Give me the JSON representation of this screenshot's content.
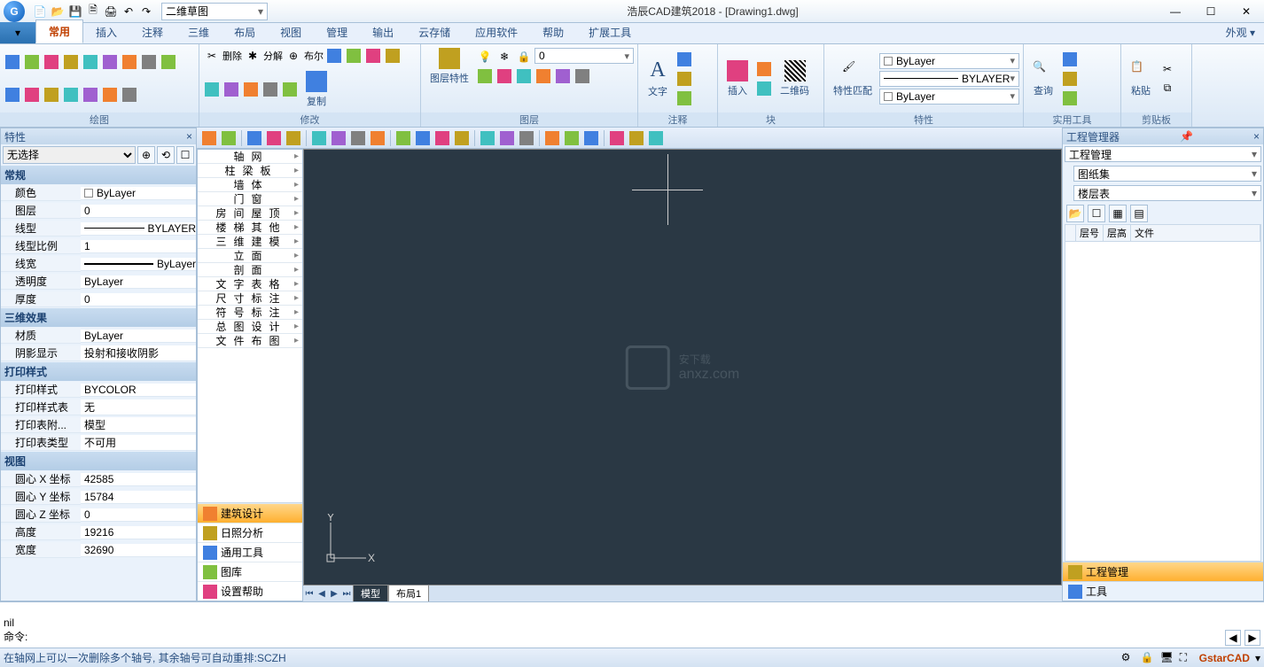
{
  "app": {
    "title": "浩辰CAD建筑2018 - [Drawing1.dwg]",
    "workspace": "二维草图",
    "brand": "GstarCAD",
    "appearance": "外观"
  },
  "tabs": [
    "常用",
    "插入",
    "注释",
    "三维",
    "布局",
    "视图",
    "管理",
    "输出",
    "云存储",
    "应用软件",
    "帮助",
    "扩展工具"
  ],
  "ribbon": {
    "groups": [
      "绘图",
      "修改",
      "图层",
      "注释",
      "块",
      "特性",
      "实用工具",
      "剪贴板"
    ],
    "btn_delete": "删除",
    "btn_explode": "分解",
    "btn_bool": "布尔",
    "btn_copy": "复制",
    "btn_text": "文字",
    "btn_insert": "插入",
    "btn_qr": "二维码",
    "btn_matchprop": "特性匹配",
    "btn_props": "图层特性",
    "btn_find": "查询",
    "btn_paste": "粘贴",
    "layer_val": "0",
    "color_val": "ByLayer",
    "ltype_val": "ByLayer",
    "lweight_val": "BYLAYER"
  },
  "props": {
    "title": "特性",
    "selection": "无选择",
    "groups": {
      "general": "常规",
      "effect3d": "三维效果",
      "plotstyle": "打印样式",
      "view": "视图"
    },
    "rows": {
      "color_l": "颜色",
      "color_v": "ByLayer",
      "layer_l": "图层",
      "layer_v": "0",
      "ltype_l": "线型",
      "ltype_v": "BYLAYER",
      "ltscale_l": "线型比例",
      "ltscale_v": "1",
      "lweight_l": "线宽",
      "lweight_v": "ByLayer",
      "trans_l": "透明度",
      "trans_v": "ByLayer",
      "thick_l": "厚度",
      "thick_v": "0",
      "mat_l": "材质",
      "mat_v": "ByLayer",
      "shadow_l": "阴影显示",
      "shadow_v": "投射和接收阴影",
      "pstyle_l": "打印样式",
      "pstyle_v": "BYCOLOR",
      "ptable_l": "打印样式表",
      "ptable_v": "无",
      "pattach_l": "打印表附...",
      "pattach_v": "模型",
      "ptype_l": "打印表类型",
      "ptype_v": "不可用",
      "cx_l": "圆心 X 坐标",
      "cx_v": "42585",
      "cy_l": "圆心 Y 坐标",
      "cy_v": "15784",
      "cz_l": "圆心 Z 坐标",
      "cz_v": "0",
      "h_l": "高度",
      "h_v": "19216",
      "w_l": "宽度",
      "w_v": "32690"
    }
  },
  "dtree": {
    "items": [
      "轴网",
      "柱梁板",
      "墙体",
      "门窗",
      "房间屋顶",
      "楼梯其他",
      "三维建模",
      "立面",
      "剖面",
      "文字表格",
      "尺寸标注",
      "符号标注",
      "总图设计",
      "文件布图"
    ],
    "tabs": {
      "design": "建筑设计",
      "sun": "日照分析",
      "tools": "通用工具",
      "gallery": "图库",
      "help": "设置帮助"
    }
  },
  "canvas": {
    "ucs_x": "X",
    "ucs_y": "Y",
    "watermark_main": "安下载",
    "watermark_sub": "anxz.com",
    "tabs": {
      "model": "模型",
      "layout1": "布局1"
    }
  },
  "pm": {
    "title": "工程管理器",
    "combo1": "工程管理",
    "combo2": "图纸集",
    "combo3": "楼层表",
    "cols": [
      "层号",
      "层高",
      "文件"
    ],
    "foot1": "工程管理",
    "foot2": "工具"
  },
  "cmd": {
    "line2": "nil",
    "prompt": "命令:"
  },
  "status": {
    "hint": "在轴网上可以一次删除多个轴号, 其余轴号可自动重排:SCZH"
  }
}
